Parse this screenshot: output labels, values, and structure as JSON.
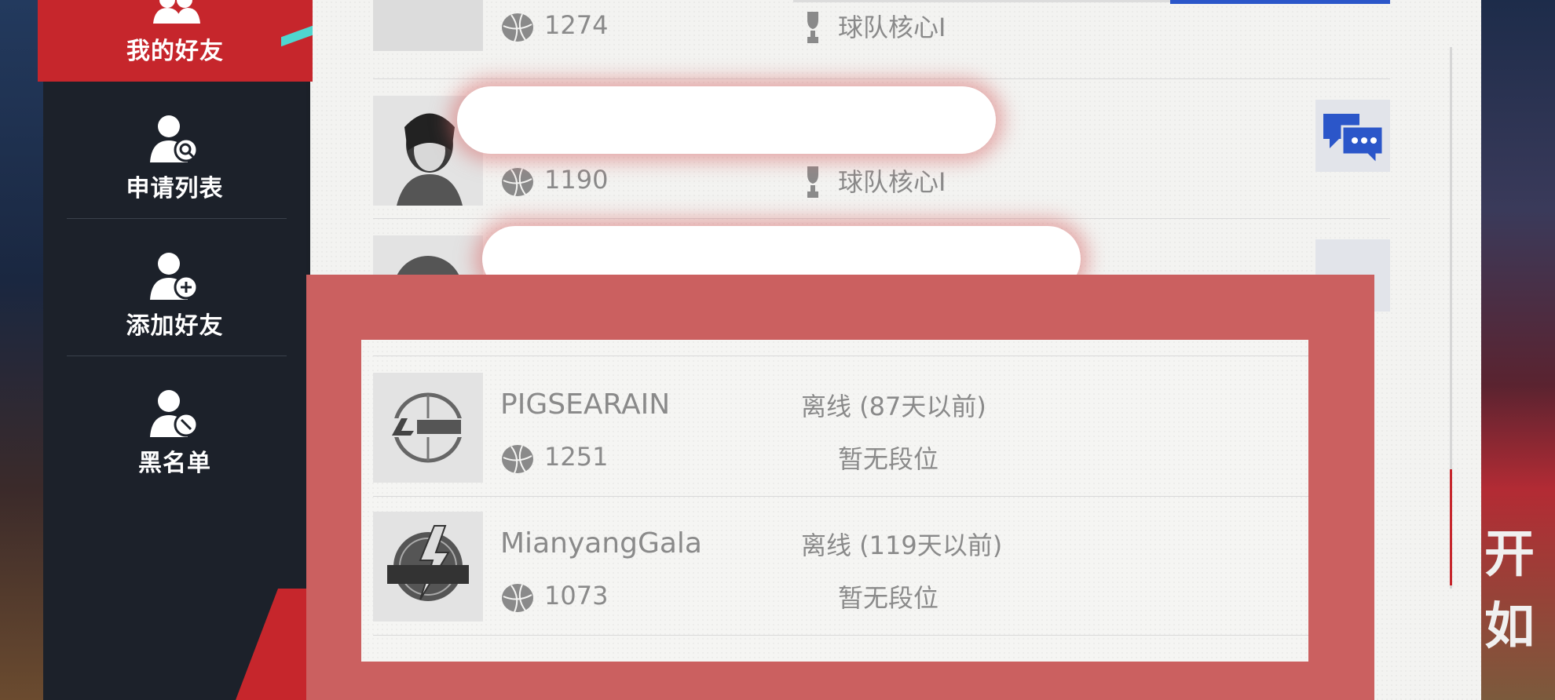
{
  "sidebar": {
    "items": [
      {
        "label": "我的好友",
        "icon": "friends-icon",
        "active": true
      },
      {
        "label": "申请列表",
        "icon": "user-search-icon"
      },
      {
        "label": "添加好友",
        "icon": "user-add-icon"
      },
      {
        "label": "黑名单",
        "icon": "user-block-icon"
      }
    ],
    "active_color": "#c6262c"
  },
  "friends": [
    {
      "name": "",
      "score": "1274",
      "rank": "球队核心I",
      "avatar": "player-avatar"
    },
    {
      "name": "",
      "score": "1190",
      "rank": "球队核心I",
      "avatar": "player-avatar"
    },
    {
      "name": "",
      "score": "",
      "rank": "",
      "avatar": "player-avatar"
    },
    {
      "name": "PIGSEARAIN",
      "score": "1251",
      "status": "离线 (87天以前)",
      "rank": "暂无段位",
      "avatar": "lakers-logo"
    },
    {
      "name": "MianyangGala",
      "score": "1073",
      "status": "离线 (119天以前)",
      "rank": "暂无段位",
      "avatar": "wade-logo"
    }
  ],
  "background_right_text": "开如",
  "colors": {
    "accent_red": "#c6262c",
    "chat_blue": "#2b56c9",
    "overlay": "#cb6060"
  }
}
